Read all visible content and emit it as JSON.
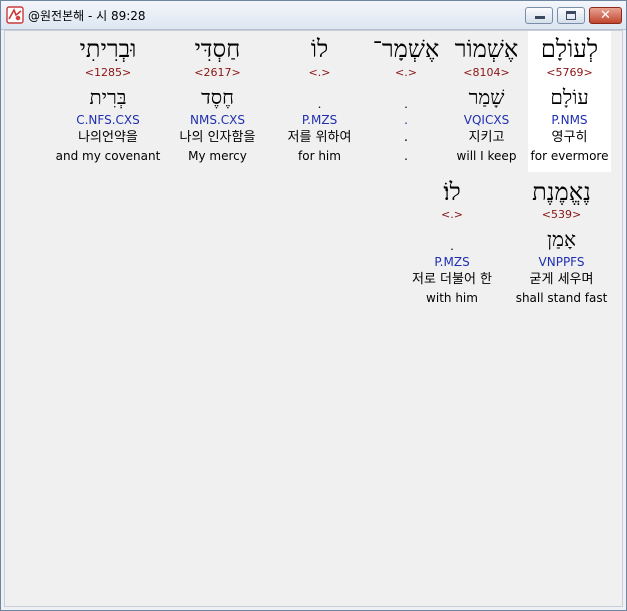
{
  "window": {
    "title": "@원전본해 - 시 89:28"
  },
  "words": [
    {
      "hebrew": "לְעוֹלָם",
      "strong": "<5769>",
      "root": "עוֹלָם",
      "morph": "P.NMS",
      "korean": "영구히",
      "english": "for evermore",
      "selected": true
    },
    {
      "hebrew": "אֶשְׁמוֹר",
      "strong": "<8104>",
      "root": "שָׁמַר",
      "morph": "VQICXS",
      "korean": "지키고",
      "english": "will I keep"
    },
    {
      "hebrew": "אֶשְׁמָר־",
      "strong": "<.>",
      "root": "ׅ",
      "morph": ".",
      "korean": ".",
      "english": "."
    },
    {
      "hebrew": "לוֹ",
      "strong": "<.>",
      "root": "ׅ",
      "morph": "P.MZS",
      "korean": "저를 위하여",
      "english": "for him"
    },
    {
      "hebrew": "חַסְדִּי",
      "strong": "<2617>",
      "root": "חֶסֶד",
      "morph": "NMS.CXS",
      "korean": "나의 인자함을",
      "english": "My mercy"
    },
    {
      "hebrew": "וּבְרִיתִי",
      "strong": "<1285>",
      "root": "בְּרִית",
      "morph": "C.NFS.CXS",
      "korean": "나의언약을",
      "english": "and my covenant"
    },
    {
      "hebrew": "נֶאֱמֶנֶת",
      "strong": "<539>",
      "root": "אָמַן",
      "morph": "VNPPFS",
      "korean": "굳게 세우며",
      "english": "shall stand fast"
    },
    {
      "hebrew": "לוֹ׃",
      "strong": "<.>",
      "root": "ׅ",
      "morph": "P.MZS",
      "korean": "저로 더불어 한",
      "english": "with him"
    }
  ]
}
